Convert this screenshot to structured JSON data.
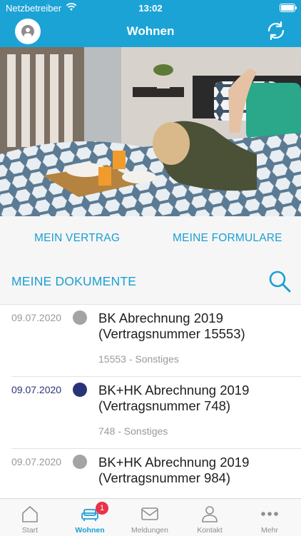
{
  "status_bar": {
    "carrier": "Netzbetreiber",
    "time": "13:02"
  },
  "nav": {
    "title": "Wohnen"
  },
  "quick_links": {
    "vertrag": "MEIN VERTRAG",
    "formulare": "MEINE FORMULARE"
  },
  "section": {
    "title": "MEINE DOKUMENTE"
  },
  "documents": [
    {
      "date": "09.07.2020",
      "title_line1": "BK Abrechnung 2019",
      "title_line2": "(Vertragsnummer 15553)",
      "meta": "15553 - Sonstiges",
      "read": true
    },
    {
      "date": "09.07.2020",
      "title_line1": "BK+HK Abrechnung 2019",
      "title_line2": "(Vertragsnummer 748)",
      "meta": "748 - Sonstiges",
      "read": false
    },
    {
      "date": "09.07.2020",
      "title_line1": "BK+HK Abrechnung 2019",
      "title_line2": "(Vertragsnummer 984)",
      "meta": "",
      "read": true
    }
  ],
  "tabs": [
    {
      "label": "Start",
      "icon": "house-icon"
    },
    {
      "label": "Wohnen",
      "icon": "sofa-icon",
      "badge": "1",
      "active": true
    },
    {
      "label": "Meldungen",
      "icon": "envelope-icon"
    },
    {
      "label": "Kontakt",
      "icon": "person-icon"
    },
    {
      "label": "Mehr",
      "icon": "more-dots-icon"
    }
  ],
  "colors": {
    "primary": "#1ba3d6",
    "unread": "#2b3378",
    "read": "#a4a4a4",
    "badge": "#e8334a"
  }
}
